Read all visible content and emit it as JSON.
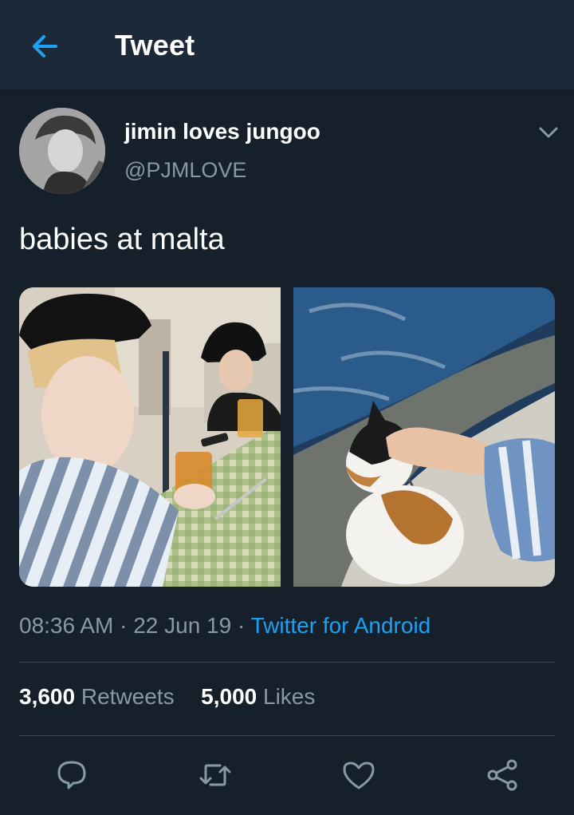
{
  "header": {
    "title": "Tweet",
    "back_icon": "back-arrow-icon",
    "accent_color": "#1da1f2"
  },
  "tweet": {
    "author": {
      "display_name": "jimin loves jungoo",
      "handle": "@PJMLOVE"
    },
    "text": "babies at malta",
    "media": [
      {
        "alt": "two people at a table with drinks and checkered tablecloth"
      },
      {
        "alt": "hand petting a calico cat beside water"
      }
    ],
    "time": "08:36 AM",
    "separator": " · ",
    "date": "22 Jun 19",
    "source": "Twitter for Android",
    "retweets_count": "3,600",
    "retweets_label": "Retweets",
    "likes_count": "5,000",
    "likes_label": "Likes"
  },
  "actions": [
    {
      "icon": "reply-icon"
    },
    {
      "icon": "retweet-icon"
    },
    {
      "icon": "like-icon"
    },
    {
      "icon": "share-icon"
    }
  ],
  "colors": {
    "background": "#15202b",
    "header": "#1c2938",
    "muted": "#8899a6",
    "link": "#1da1f2"
  }
}
